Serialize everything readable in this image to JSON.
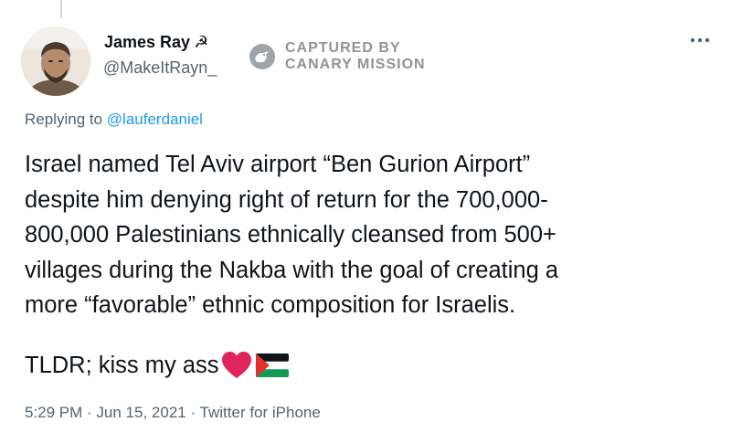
{
  "author": {
    "display_name": "James Ray",
    "name_badge": "☭",
    "handle": "@MakeItRayn_"
  },
  "watermark": {
    "line1": "CAPTURED BY",
    "line2": "CANARY MISSION",
    "icon": "canary-bird-icon"
  },
  "menu": {
    "icon": "more-dots-icon",
    "glyph": "•••"
  },
  "reply": {
    "prefix": "Replying to ",
    "mention": "@lauferdaniel"
  },
  "tweet": {
    "lines": [
      "Israel named Tel Aviv airport “Ben Gurion Airport”",
      "despite him denying right of return for the 700,000-",
      "800,000 Palestinians ethnically cleansed from 500+",
      "villages during the Nakba with the goal of creating a",
      "more “favorable” ethnic composition for Israelis."
    ],
    "closing": "TLDR; kiss my ass",
    "emojis": [
      "red-heart-icon",
      "palestine-flag-icon"
    ]
  },
  "meta": {
    "time": "5:29 PM",
    "date": "Jun 15, 2021",
    "source": "Twitter for iPhone",
    "separator": " · "
  },
  "colors": {
    "text": "#0f1419",
    "secondary": "#536471",
    "link": "#1d9bf0",
    "heart": "#e0245e",
    "watermark": "#8a8f93"
  }
}
